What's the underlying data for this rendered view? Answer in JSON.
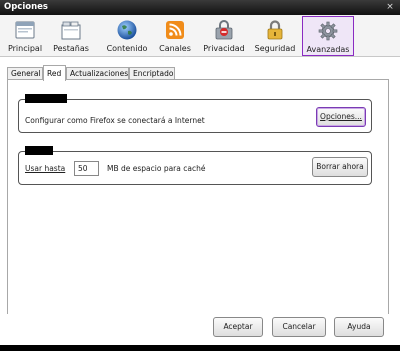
{
  "window": {
    "title": "Opciones",
    "close_glyph": "×"
  },
  "toolbar": {
    "items": [
      {
        "label": "Principal",
        "icon": "window-icon"
      },
      {
        "label": "Pestañas",
        "icon": "tabs-icon"
      },
      {
        "label": "Contenido",
        "icon": "globe-icon"
      },
      {
        "label": "Canales",
        "icon": "rss-icon"
      },
      {
        "label": "Privacidad",
        "icon": "privacy-icon"
      },
      {
        "label": "Seguridad",
        "icon": "lock-icon"
      },
      {
        "label": "Avanzadas",
        "icon": "gear-icon"
      }
    ],
    "active_index": 6
  },
  "tabs": {
    "items": [
      "General",
      "Red",
      "Actualizaciones",
      "Encriptado"
    ],
    "active_index": 1
  },
  "connection": {
    "description": "Configurar como Firefox se conectará a Internet",
    "settings_button": "Opciones..."
  },
  "cache": {
    "use_label": "Usar hasta",
    "size_value": "50",
    "unit_label": "MB de espacio para caché",
    "clear_button": "Borrar ahora"
  },
  "footer": {
    "ok_button": "Aceptar",
    "cancel_button": "Cancelar",
    "help_button": "Ayuda"
  },
  "colors": {
    "active_highlight": "#8a2bc2",
    "active_bg": "#efe6f7"
  }
}
